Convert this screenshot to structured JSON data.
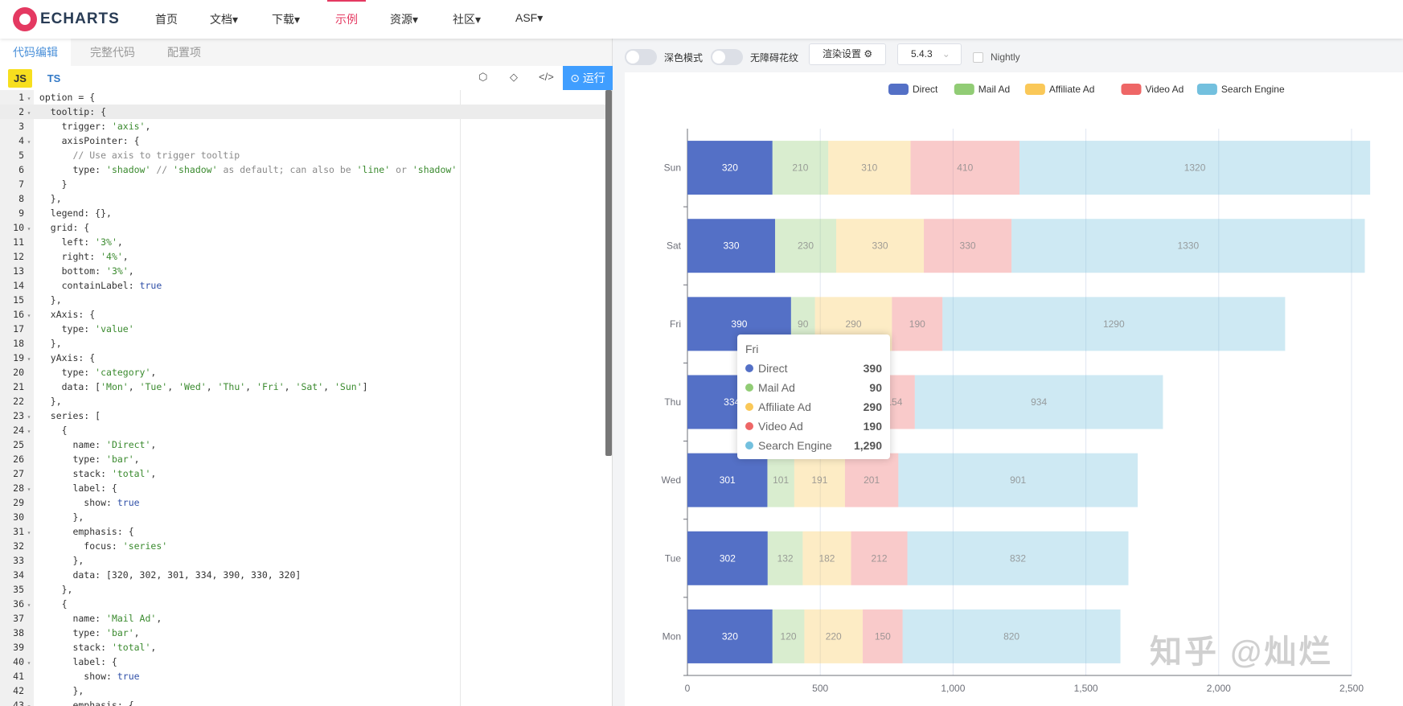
{
  "nav": {
    "logo": "ECHARTS",
    "items": [
      {
        "label": "首页"
      },
      {
        "label": "文档▾"
      },
      {
        "label": "下载▾"
      },
      {
        "label": "示例",
        "active": true
      },
      {
        "label": "资源▾"
      },
      {
        "label": "社区▾"
      },
      {
        "label": "ASF▾"
      }
    ]
  },
  "editor": {
    "tabs": [
      "代码编辑",
      "完整代码",
      "配置项"
    ],
    "lang_js": "JS",
    "lang_ts": "TS",
    "run_label": "运行",
    "run_icon": "play-circle-icon",
    "lines": [
      "option = {",
      "  tooltip: {",
      "    trigger: 'axis',",
      "    axisPointer: {",
      "      // Use axis to trigger tooltip",
      "      type: 'shadow' // 'shadow' as default; can also be 'line' or 'shadow'",
      "    }",
      "  },",
      "  legend: {},",
      "  grid: {",
      "    left: '3%',",
      "    right: '4%',",
      "    bottom: '3%',",
      "    containLabel: true",
      "  },",
      "  xAxis: {",
      "    type: 'value'",
      "  },",
      "  yAxis: {",
      "    type: 'category',",
      "    data: ['Mon', 'Tue', 'Wed', 'Thu', 'Fri', 'Sat', 'Sun']",
      "  },",
      "  series: [",
      "    {",
      "      name: 'Direct',",
      "      type: 'bar',",
      "      stack: 'total',",
      "      label: {",
      "        show: true",
      "      },",
      "      emphasis: {",
      "        focus: 'series'",
      "      },",
      "      data: [320, 302, 301, 334, 390, 330, 320]",
      "    },",
      "    {",
      "      name: 'Mail Ad',",
      "      type: 'bar',",
      "      stack: 'total',",
      "      label: {",
      "        show: true",
      "      },",
      "      emphasis: {"
    ],
    "fold_lines": [
      1,
      2,
      4,
      10,
      16,
      19,
      23,
      24,
      28,
      31,
      36,
      40,
      43
    ]
  },
  "controls": {
    "dark_mode": "深色模式",
    "aria_decal": "无障碍花纹",
    "render_settings": "渲染设置 ⚙",
    "version": "5.4.3",
    "nightly": "Nightly"
  },
  "chart_data": {
    "type": "bar",
    "orientation": "horizontal",
    "stacked": true,
    "categories": [
      "Mon",
      "Tue",
      "Wed",
      "Thu",
      "Fri",
      "Sat",
      "Sun"
    ],
    "series": [
      {
        "name": "Direct",
        "color": "#5470c6",
        "values": [
          320,
          302,
          301,
          334,
          390,
          330,
          320
        ]
      },
      {
        "name": "Mail Ad",
        "color": "#91cc75",
        "values": [
          120,
          132,
          101,
          134,
          90,
          230,
          210
        ]
      },
      {
        "name": "Affiliate Ad",
        "color": "#fac858",
        "values": [
          220,
          182,
          191,
          234,
          290,
          330,
          310
        ]
      },
      {
        "name": "Video Ad",
        "color": "#ee6666",
        "values": [
          150,
          212,
          201,
          154,
          190,
          330,
          410
        ]
      },
      {
        "name": "Search Engine",
        "color": "#73c0de",
        "values": [
          820,
          832,
          901,
          934,
          1290,
          1330,
          1320
        ]
      }
    ],
    "xlim": [
      0,
      2500
    ],
    "xticks": [
      "0",
      "500",
      "1,000",
      "1,500",
      "2,000",
      "2,500"
    ],
    "legend": "top-center",
    "grid": true,
    "emphasis_series": "Direct"
  },
  "tooltip": {
    "title": "Fri",
    "rows": [
      {
        "name": "Direct",
        "value": "390",
        "color": "#5470c6"
      },
      {
        "name": "Mail Ad",
        "value": "90",
        "color": "#91cc75"
      },
      {
        "name": "Affiliate Ad",
        "value": "290",
        "color": "#fac858"
      },
      {
        "name": "Video Ad",
        "value": "190",
        "color": "#ee6666"
      },
      {
        "name": "Search Engine",
        "value": "1,290",
        "color": "#73c0de"
      }
    ]
  },
  "watermark": "知乎 @灿烂"
}
